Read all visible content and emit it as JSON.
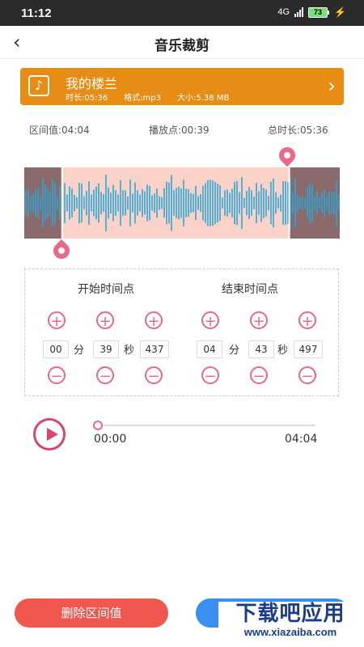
{
  "status": {
    "time": "11:12",
    "network": "4G",
    "battery": "73"
  },
  "header": {
    "back_icon": "chevron-left-icon",
    "title": "音乐裁剪"
  },
  "music": {
    "name": "我的楼兰",
    "duration": "时长:05:36",
    "format": "格式:mp3",
    "size": "大小:5.38 MB",
    "bg_color": "#e78c15"
  },
  "info": {
    "interval": "区间值:04:04",
    "play_point": "播放点:00:39",
    "total": "总时长:05:36"
  },
  "waveform": {
    "selected_start_fraction": 0.12,
    "selected_end_fraction": 0.84,
    "accent": "#e8698a",
    "wave_color": "#2aa7d8"
  },
  "start": {
    "label": "开始时间点",
    "min": "00",
    "min_unit": "分",
    "sec": "39",
    "sec_unit": "秒",
    "ms": "437"
  },
  "end": {
    "label": "结束时间点",
    "min": "04",
    "min_unit": "分",
    "sec": "43",
    "sec_unit": "秒",
    "ms": "497"
  },
  "player": {
    "current": "00:00",
    "total": "04:04",
    "progress": 0.0
  },
  "buttons": {
    "delete": "删除区间值",
    "right": ""
  },
  "watermark": {
    "big": "下载吧应用",
    "small": "www.xiazaiba.com"
  }
}
